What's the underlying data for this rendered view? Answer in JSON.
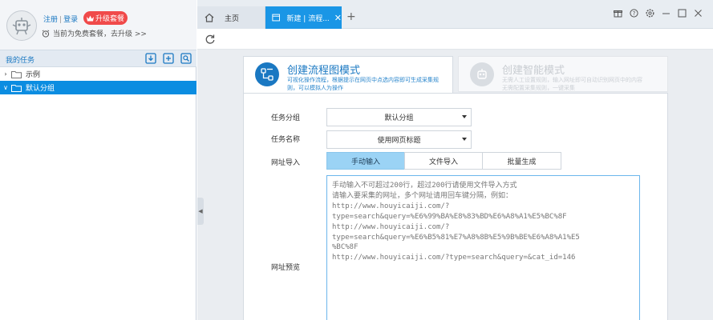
{
  "user": {
    "register_label": "注册",
    "login_label": "登录",
    "upgrade_label": "升级套餐",
    "free_notice": "当前为免费套餐，去升级 >>"
  },
  "sidebar": {
    "title": "我的任务",
    "tree": [
      {
        "label": "示例",
        "expanded": false,
        "selected": false
      },
      {
        "label": "默认分组",
        "expanded": true,
        "selected": true
      }
    ]
  },
  "tabs": [
    {
      "label": "主页",
      "active": false
    },
    {
      "label": "新建 | 流程...",
      "active": true
    }
  ],
  "mode_cards": [
    {
      "title": "创建流程图模式",
      "desc_line1": "可视化操作流程，根据提示在网页中点选内容即可生成采集规",
      "desc_line2": "则，可以模拟人为操作"
    },
    {
      "title": "创建智能模式",
      "desc_line1": "无需人工设置规则，输入网址即可自动识别网页中的内容",
      "desc_line2": "无需配置采集规则，一键采集"
    }
  ],
  "form": {
    "group_label": "任务分组",
    "group_value": "默认分组",
    "name_label": "任务名称",
    "name_value": "使用网页标题",
    "url_import_label": "网址导入",
    "import_options": [
      "手动输入",
      "文件导入",
      "批量生成"
    ],
    "selected_import": "手动输入",
    "url_preview_label": "网址预览",
    "textarea_text": "手动输入不可超过200行，超过200行请使用文件导入方式\n请输入要采集的网址，多个网址请用回车键分隔，例如：\nhttp://www.houyicaiji.com/?\ntype=search&query=%E6%99%BA%E8%83%BD%E6%A8%A1%E5%BC%8F\nhttp://www.houyicaiji.com/?\ntype=search&query=%E6%B5%81%E7%A8%8B%E5%9B%BE%E6%A8%A1%E5\n%BC%8F\nhttp://www.houyicaiji.com/?type=search&query=&cat_id=146"
  },
  "colors": {
    "accent": "#1a96e6",
    "selected_row": "#0b8de1",
    "upgrade_badge": "#f04a4a",
    "segment_active": "#9bd3f5"
  },
  "icons": [
    "robot-avatar-icon",
    "alarm-clock-icon",
    "crown-icon",
    "import-icon",
    "add-icon",
    "search-doc-icon",
    "home-icon",
    "page-icon",
    "close-icon",
    "plus-icon",
    "gift-icon",
    "help-icon",
    "settings-icon",
    "minimize-icon",
    "maximize-icon",
    "refresh-icon",
    "flow-chart-icon",
    "robot-icon"
  ]
}
